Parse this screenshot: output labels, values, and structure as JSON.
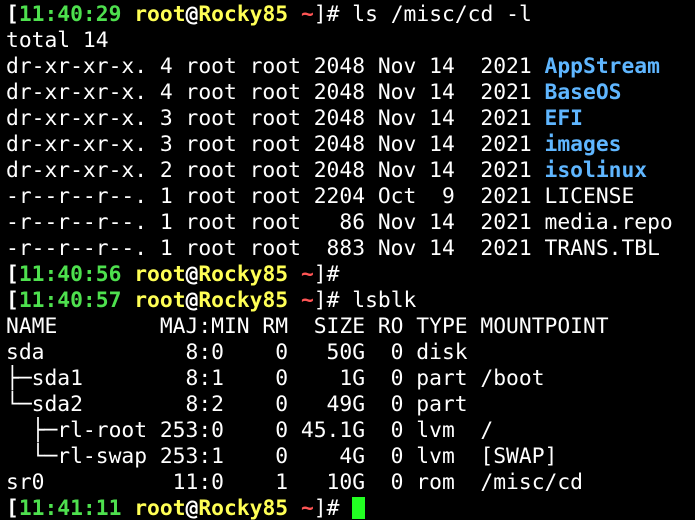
{
  "colors": {
    "background": "#000000",
    "foreground": "#ffffff",
    "prompt_time": "#4ee04e",
    "prompt_user_host": "#ffff55",
    "prompt_dir": "#ff5555",
    "directory": "#5fb6ff",
    "cursor": "#22ff22"
  },
  "prompts": [
    {
      "open": "[",
      "time": "11:40:29",
      "user": "root",
      "at": "@",
      "host": "Rocky85",
      "dir": " ~",
      "close": "]#",
      "command": " ls /misc/cd -l"
    },
    {
      "open": "[",
      "time": "11:40:56",
      "user": "root",
      "at": "@",
      "host": "Rocky85",
      "dir": " ~",
      "close": "]#",
      "command": ""
    },
    {
      "open": "[",
      "time": "11:40:57",
      "user": "root",
      "at": "@",
      "host": "Rocky85",
      "dir": " ~",
      "close": "]#",
      "command": " lsblk"
    },
    {
      "open": "[",
      "time": "11:41:11",
      "user": "root",
      "at": "@",
      "host": "Rocky85",
      "dir": " ~",
      "close": "]#",
      "command": " "
    }
  ],
  "ls_output": {
    "total": "total 14",
    "entries": [
      {
        "meta": "dr-xr-xr-x. 4 root root 2048 Nov 14  2021 ",
        "name": "AppStream",
        "is_dir": true
      },
      {
        "meta": "dr-xr-xr-x. 4 root root 2048 Nov 14  2021 ",
        "name": "BaseOS",
        "is_dir": true
      },
      {
        "meta": "dr-xr-xr-x. 3 root root 2048 Nov 14  2021 ",
        "name": "EFI",
        "is_dir": true
      },
      {
        "meta": "dr-xr-xr-x. 3 root root 2048 Nov 14  2021 ",
        "name": "images",
        "is_dir": true
      },
      {
        "meta": "dr-xr-xr-x. 2 root root 2048 Nov 14  2021 ",
        "name": "isolinux",
        "is_dir": true
      },
      {
        "meta": "-r--r--r--. 1 root root 2204 Oct  9  2021 ",
        "name": "LICENSE",
        "is_dir": false
      },
      {
        "meta": "-r--r--r--. 1 root root   86 Nov 14  2021 ",
        "name": "media.repo",
        "is_dir": false
      },
      {
        "meta": "-r--r--r--. 1 root root  883 Nov 14  2021 ",
        "name": "TRANS.TBL",
        "is_dir": false
      }
    ]
  },
  "lsblk_output": [
    "NAME        MAJ:MIN RM  SIZE RO TYPE MOUNTPOINT",
    "sda           8:0    0   50G  0 disk",
    "├─sda1        8:1    0    1G  0 part /boot",
    "└─sda2        8:2    0   49G  0 part",
    "  ├─rl-root 253:0    0 45.1G  0 lvm  /",
    "  └─rl-swap 253:1    0    4G  0 lvm  [SWAP]",
    "sr0          11:0    1   10G  0 rom  /misc/cd"
  ]
}
